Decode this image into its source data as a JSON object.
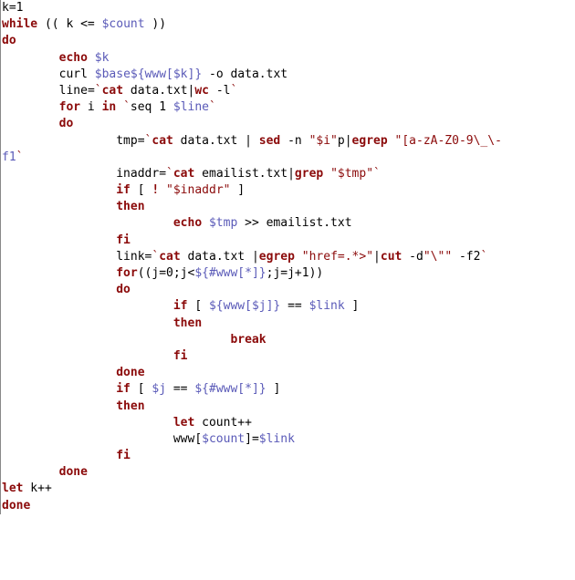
{
  "code": {
    "lines": [
      [
        {
          "t": "id",
          "v": "k"
        },
        {
          "t": "op",
          "v": "="
        },
        {
          "t": "op",
          "v": "1"
        }
      ],
      [
        {
          "t": "kw",
          "v": "while"
        },
        {
          "t": "op",
          "v": " (( "
        },
        {
          "t": "id",
          "v": "k"
        },
        {
          "t": "op",
          "v": " <= "
        },
        {
          "t": "var",
          "v": "$count"
        },
        {
          "t": "op",
          "v": " ))"
        }
      ],
      [
        {
          "t": "kw",
          "v": "do"
        }
      ],
      [
        {
          "t": "op",
          "v": "        "
        },
        {
          "t": "cmd",
          "v": "echo"
        },
        {
          "t": "op",
          "v": " "
        },
        {
          "t": "var",
          "v": "$k"
        }
      ],
      [
        {
          "t": "op",
          "v": "        "
        },
        {
          "t": "id",
          "v": "curl"
        },
        {
          "t": "op",
          "v": " "
        },
        {
          "t": "var",
          "v": "$base${www[$k]}"
        },
        {
          "t": "op",
          "v": " -o data.txt"
        }
      ],
      [
        {
          "t": "op",
          "v": "        "
        },
        {
          "t": "id",
          "v": "line"
        },
        {
          "t": "op",
          "v": "="
        },
        {
          "t": "bt",
          "v": "`"
        },
        {
          "t": "cmd",
          "v": "cat"
        },
        {
          "t": "op",
          "v": " data.txt"
        },
        {
          "t": "op",
          "v": "|"
        },
        {
          "t": "cmd",
          "v": "wc"
        },
        {
          "t": "op",
          "v": " -l"
        },
        {
          "t": "bt",
          "v": "`"
        }
      ],
      [
        {
          "t": "op",
          "v": "        "
        },
        {
          "t": "kw",
          "v": "for"
        },
        {
          "t": "op",
          "v": " i "
        },
        {
          "t": "kw",
          "v": "in"
        },
        {
          "t": "op",
          "v": " "
        },
        {
          "t": "bt",
          "v": "`"
        },
        {
          "t": "id",
          "v": "seq"
        },
        {
          "t": "op",
          "v": " 1 "
        },
        {
          "t": "var",
          "v": "$line"
        },
        {
          "t": "bt",
          "v": "`"
        }
      ],
      [
        {
          "t": "op",
          "v": "        "
        },
        {
          "t": "kw",
          "v": "do"
        }
      ],
      [
        {
          "t": "op",
          "v": "                "
        },
        {
          "t": "id",
          "v": "tmp"
        },
        {
          "t": "op",
          "v": "="
        },
        {
          "t": "bt",
          "v": "`"
        },
        {
          "t": "cmd",
          "v": "cat"
        },
        {
          "t": "op",
          "v": " data.txt | "
        },
        {
          "t": "cmd",
          "v": "sed"
        },
        {
          "t": "op",
          "v": " -n "
        },
        {
          "t": "str",
          "v": "\"$i\""
        },
        {
          "t": "op",
          "v": "p|"
        },
        {
          "t": "cmd",
          "v": "egrep"
        },
        {
          "t": "op",
          "v": " "
        },
        {
          "t": "str",
          "v": "\"[a-zA-Z0-9\\_\\-"
        }
      ],
      [
        {
          "t": "var",
          "v": "f1"
        },
        {
          "t": "bt",
          "v": "`"
        }
      ],
      [
        {
          "t": "op",
          "v": "                "
        },
        {
          "t": "id",
          "v": "inaddr"
        },
        {
          "t": "op",
          "v": "="
        },
        {
          "t": "bt",
          "v": "`"
        },
        {
          "t": "cmd",
          "v": "cat"
        },
        {
          "t": "op",
          "v": " emailist.txt"
        },
        {
          "t": "op",
          "v": "|"
        },
        {
          "t": "cmd",
          "v": "grep"
        },
        {
          "t": "op",
          "v": " "
        },
        {
          "t": "str",
          "v": "\"$tmp\""
        },
        {
          "t": "bt",
          "v": "`"
        }
      ],
      [
        {
          "t": "op",
          "v": "                "
        },
        {
          "t": "kw",
          "v": "if"
        },
        {
          "t": "op",
          "v": " [ "
        },
        {
          "t": "cmd",
          "v": "!"
        },
        {
          "t": "op",
          "v": " "
        },
        {
          "t": "str",
          "v": "\"$inaddr\""
        },
        {
          "t": "op",
          "v": " ]"
        }
      ],
      [
        {
          "t": "op",
          "v": "                "
        },
        {
          "t": "kw",
          "v": "then"
        }
      ],
      [
        {
          "t": "op",
          "v": "                        "
        },
        {
          "t": "cmd",
          "v": "echo"
        },
        {
          "t": "op",
          "v": " "
        },
        {
          "t": "var",
          "v": "$tmp"
        },
        {
          "t": "op",
          "v": " >> emailist.txt"
        }
      ],
      [
        {
          "t": "op",
          "v": "                "
        },
        {
          "t": "kw",
          "v": "fi"
        }
      ],
      [
        {
          "t": "op",
          "v": ""
        }
      ],
      [
        {
          "t": "op",
          "v": "                "
        },
        {
          "t": "id",
          "v": "link"
        },
        {
          "t": "op",
          "v": "="
        },
        {
          "t": "bt",
          "v": "`"
        },
        {
          "t": "cmd",
          "v": "cat"
        },
        {
          "t": "op",
          "v": " data.txt "
        },
        {
          "t": "op",
          "v": "|"
        },
        {
          "t": "cmd",
          "v": "egrep"
        },
        {
          "t": "op",
          "v": " "
        },
        {
          "t": "str",
          "v": "\"href=.*>\""
        },
        {
          "t": "op",
          "v": "|"
        },
        {
          "t": "cmd",
          "v": "cut"
        },
        {
          "t": "op",
          "v": " -d"
        },
        {
          "t": "str",
          "v": "\"\\\"\""
        },
        {
          "t": "op",
          "v": " -f2"
        },
        {
          "t": "bt",
          "v": "`"
        }
      ],
      [
        {
          "t": "op",
          "v": ""
        }
      ],
      [
        {
          "t": "op",
          "v": "                "
        },
        {
          "t": "kw",
          "v": "for"
        },
        {
          "t": "op",
          "v": "((j=0;j<"
        },
        {
          "t": "var",
          "v": "${#www[*]}"
        },
        {
          "t": "op",
          "v": ";j=j+1))"
        }
      ],
      [
        {
          "t": "op",
          "v": "                "
        },
        {
          "t": "kw",
          "v": "do"
        }
      ],
      [
        {
          "t": "op",
          "v": "                        "
        },
        {
          "t": "kw",
          "v": "if"
        },
        {
          "t": "op",
          "v": " [ "
        },
        {
          "t": "var",
          "v": "${www[$j]}"
        },
        {
          "t": "op",
          "v": " == "
        },
        {
          "t": "var",
          "v": "$link"
        },
        {
          "t": "op",
          "v": " ]"
        }
      ],
      [
        {
          "t": "op",
          "v": "                        "
        },
        {
          "t": "kw",
          "v": "then"
        }
      ],
      [
        {
          "t": "op",
          "v": "                                "
        },
        {
          "t": "kw",
          "v": "break"
        }
      ],
      [
        {
          "t": "op",
          "v": "                        "
        },
        {
          "t": "kw",
          "v": "fi"
        }
      ],
      [
        {
          "t": "op",
          "v": "                "
        },
        {
          "t": "kw",
          "v": "done"
        }
      ],
      [
        {
          "t": "op",
          "v": ""
        }
      ],
      [
        {
          "t": "op",
          "v": "                "
        },
        {
          "t": "kw",
          "v": "if"
        },
        {
          "t": "op",
          "v": " [ "
        },
        {
          "t": "var",
          "v": "$j"
        },
        {
          "t": "op",
          "v": " == "
        },
        {
          "t": "var",
          "v": "${#www[*]}"
        },
        {
          "t": "op",
          "v": " ]"
        }
      ],
      [
        {
          "t": "op",
          "v": "                "
        },
        {
          "t": "kw",
          "v": "then"
        }
      ],
      [
        {
          "t": "op",
          "v": "                        "
        },
        {
          "t": "cmd",
          "v": "let"
        },
        {
          "t": "op",
          "v": " count++"
        }
      ],
      [
        {
          "t": "op",
          "v": "                        "
        },
        {
          "t": "id",
          "v": "www"
        },
        {
          "t": "op",
          "v": "["
        },
        {
          "t": "var",
          "v": "$count"
        },
        {
          "t": "op",
          "v": "]="
        },
        {
          "t": "var",
          "v": "$link"
        }
      ],
      [
        {
          "t": "op",
          "v": ""
        }
      ],
      [
        {
          "t": "op",
          "v": "                "
        },
        {
          "t": "kw",
          "v": "fi"
        }
      ],
      [
        {
          "t": "op",
          "v": "        "
        },
        {
          "t": "kw",
          "v": "done"
        }
      ],
      [
        {
          "t": "cmd",
          "v": "let"
        },
        {
          "t": "op",
          "v": " k++"
        }
      ],
      [
        {
          "t": "kw",
          "v": "done"
        }
      ]
    ]
  }
}
